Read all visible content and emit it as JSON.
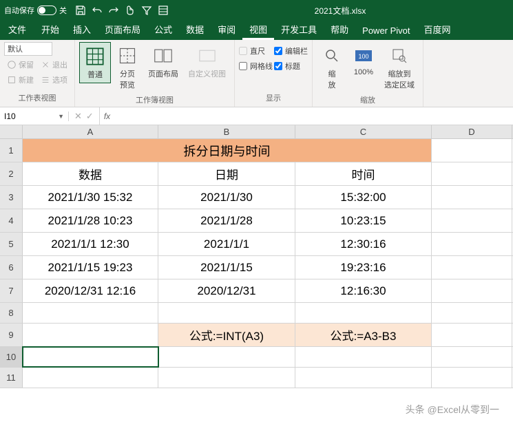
{
  "titlebar": {
    "autosave_label": "自动保存",
    "autosave_state": "关",
    "doc_title": "2021文档.xlsx"
  },
  "tabs": {
    "file": "文件",
    "home": "开始",
    "insert": "插入",
    "layout": "页面布局",
    "formula": "公式",
    "data": "数据",
    "review": "审阅",
    "view": "视图",
    "dev": "开发工具",
    "help": "帮助",
    "powerpivot": "Power Pivot",
    "baidu": "百度网"
  },
  "ribbon": {
    "sheetview": {
      "default": "默认",
      "keep": "保留",
      "exit": "退出",
      "new": "新建",
      "options": "选项",
      "label": "工作表视图"
    },
    "bookview": {
      "normal": "普通",
      "pagebreak": "分页\n预览",
      "pagelayout": "页面布局",
      "custom": "自定义视图",
      "label": "工作簿视图"
    },
    "show": {
      "ruler": "直尺",
      "formulabar": "编辑栏",
      "gridlines": "网格线",
      "headings": "标题",
      "label": "显示"
    },
    "zoom": {
      "zoom": "缩\n放",
      "hundred": "100%",
      "selection": "缩放到\n选定区域",
      "label": "缩放"
    }
  },
  "formula_bar": {
    "name_box": "I10"
  },
  "columns": [
    "A",
    "B",
    "C",
    "D"
  ],
  "rows": [
    "1",
    "2",
    "3",
    "4",
    "5",
    "6",
    "7",
    "8",
    "9",
    "10",
    "11"
  ],
  "cells": {
    "title": "拆分日期与时间",
    "headers": {
      "a": "数据",
      "b": "日期",
      "c": "时间"
    },
    "r3": {
      "a": "2021/1/30 15:32",
      "b": "2021/1/30",
      "c": "15:32:00"
    },
    "r4": {
      "a": "2021/1/28 10:23",
      "b": "2021/1/28",
      "c": "10:23:15"
    },
    "r5": {
      "a": "2021/1/1 12:30",
      "b": "2021/1/1",
      "c": "12:30:16"
    },
    "r6": {
      "a": "2021/1/15 19:23",
      "b": "2021/1/15",
      "c": "19:23:16"
    },
    "r7": {
      "a": "2020/12/31 12:16",
      "b": "2020/12/31",
      "c": "12:16:30"
    },
    "r9": {
      "b": "公式:=INT(A3)",
      "c": "公式:=A3-B3"
    }
  },
  "watermark": "头条 @Excel从零到一"
}
